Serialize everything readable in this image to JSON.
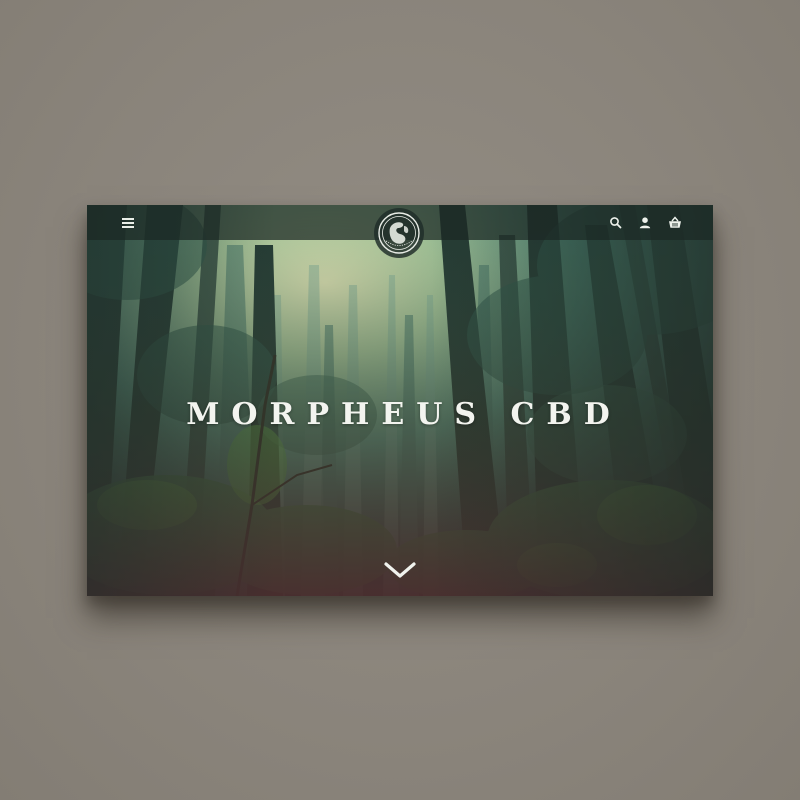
{
  "header": {
    "menu_icon": "hamburger-menu-icon",
    "logo_icon": "morpheus-cbd-globe-logo",
    "actions": [
      {
        "name": "search-icon"
      },
      {
        "name": "user-account-icon"
      },
      {
        "name": "shopping-basket-icon"
      }
    ]
  },
  "hero": {
    "title": "MORPHEUS CBD",
    "scroll_icon": "chevron-down-icon"
  },
  "colors": {
    "page_background": "#8c867d",
    "header_bar": "#1c2824",
    "title_text": "#f3f4ef"
  }
}
